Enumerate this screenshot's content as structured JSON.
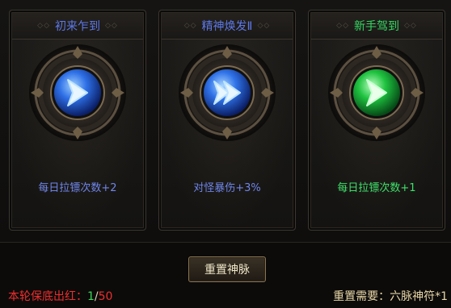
{
  "cards": [
    {
      "title": "初来乍到",
      "effect": "每日拉镖次数+2",
      "icon": "chevron-arrow-icon",
      "orb_color": "#2d6fe6"
    },
    {
      "title": "精神焕发Ⅱ",
      "effect": "对怪暴伤+3%",
      "icon": "fast-forward-arrow-icon",
      "orb_color": "#2d6fe6"
    },
    {
      "title": "新手驾到",
      "effect": "每日拉镖次数+1",
      "icon": "chevron-arrow-icon",
      "orb_color": "#1fc23f"
    }
  ],
  "reset_button": {
    "label": "重置神脉"
  },
  "footer": {
    "guarantee_label": "本轮保底出红：",
    "current": "1",
    "separator": "/",
    "max": "50",
    "cost_label": "重置需要：六脉神符*1"
  },
  "colors": {
    "blue_text": "#6f86ea",
    "green_text": "#3ee06a",
    "red_text": "#ee2d2d",
    "gold_text": "#e8d6a6"
  }
}
